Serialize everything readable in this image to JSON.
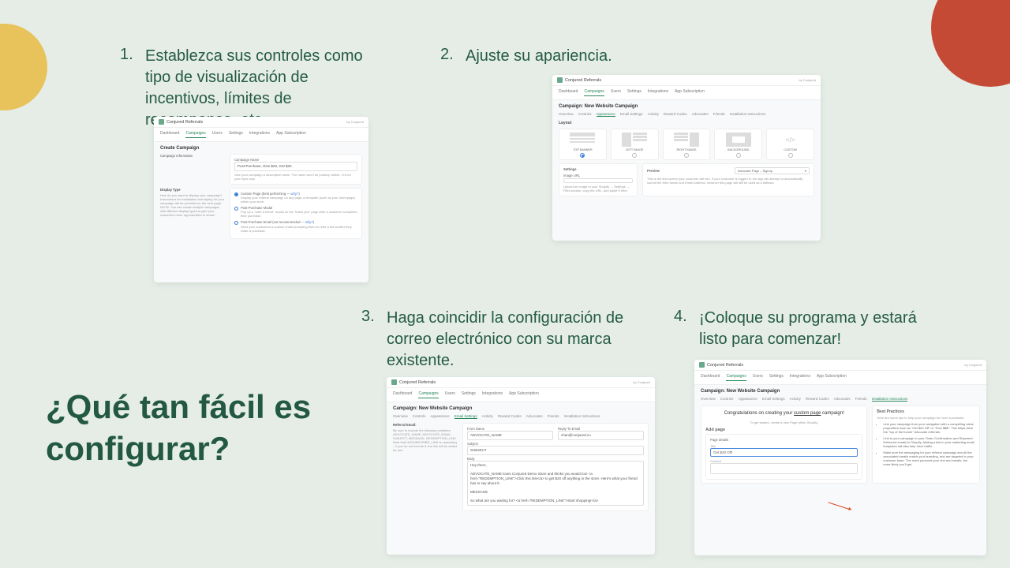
{
  "headline": "¿Qué tan fácil es configurar?",
  "steps": {
    "s1": {
      "num": "1.",
      "text": "Establezca sus controles como tipo de visualización de incentivos, límites de recompensa, etc."
    },
    "s2": {
      "num": "2.",
      "text": "Ajuste su apariencia."
    },
    "s3": {
      "num": "3.",
      "text": "Haga coincidir la configuración de correo electrónico con su marca existente."
    },
    "s4": {
      "num": "4.",
      "text": "¡Coloque su programa y estará listo para comenzar!"
    }
  },
  "app": {
    "title": "Conjured Referrals",
    "by": "by Conjured",
    "nav": [
      "Dashboard",
      "Campaigns",
      "Users",
      "Settings",
      "Integrations",
      "App Subscription"
    ],
    "subtabs": [
      "Overview",
      "Controls",
      "Appearance",
      "Email Settings",
      "Activity",
      "Reward Codes",
      "Advocates",
      "Friends",
      "Installation Instructions"
    ]
  },
  "shot1": {
    "heading": "Create Campaign",
    "sectionA": {
      "label": "Campaign Information",
      "fieldLabel": "Campaign Name",
      "value": "Post-Purchase, Give $20, Get $20",
      "hint": "Give your campaign a descriptive name. The name won't be publicly visible – it's for your eyes only."
    },
    "sectionB": {
      "label": "Display Type",
      "desc": "How do you want to display your campaign? Instructions for installation and styling for your campaign will be provided on the next page. NOTE: You can create multiple campaigns with different display types to give your customers more opportunities to share!",
      "opts": [
        {
          "title": "Custom Page (best performing — ",
          "why": "why?",
          "tail": ")",
          "sub": "Display your referral campaign on any page or template (such as your homepage) within your store."
        },
        {
          "title": "Post-Purchase Modal",
          "sub": "Pop up a \"refer a friend\" modal on the \"thank you\" page after a customer completes their purchase."
        },
        {
          "title": "Post-Purchase Email (not recommended — ",
          "why": "why?",
          "tail": ")",
          "sub": "Send your customers a custom email prompting them to refer a friend after they make a purchase."
        }
      ]
    }
  },
  "shot2": {
    "heading": "Campaign: New Website Campaign",
    "layoutLabel": "Layout",
    "layouts": [
      "TOP BANNER",
      "LEFT IMAGE",
      "RIGHT IMAGE",
      "BACKGROUND",
      "CUSTOM"
    ],
    "settingsLabel": "Settings",
    "imageUrl": "Image URL",
    "imageHint": "Upload an image to your Shopify → Settings → Files section, copy the URL, and paste it here.",
    "previewLabel": "Preview ",
    "previewSelect": "Advocate Page – Signup",
    "previewText": "This is the first screen your customer will see. If your customer is logged in, the app will attempt to automatically submit the their Name and Email Address, however this page will still be used as a fallback."
  },
  "shot3": {
    "heading": "Campaign: New Website Campaign",
    "left": {
      "label": "Referral Email:",
      "text": "Be sure to include the following variables: ADVOCATE_NAME, ADVOCATE_EMAIL, SUBJECT, MESSAGE, REDEMPTION_LINK. Note that UNSUBSCRIBE_LINK is mandatory – if you do not include it, the link will be added for you."
    },
    "right": {
      "fromLabel": "From Name",
      "fromVal": "ADVOCATE_NAME",
      "replyLabel": "Reply-To Email",
      "replyVal": "chan@conjured.co",
      "subjLabel": "Subject",
      "subjVal": "SUBJECT",
      "bodyLabel": "Body",
      "bodyText": "Hey there,\n\nADVOCATE_NAME loves Conjured Demo Store and thinks you would too! <a href=\"REDEMPTION_LINK\">Click this link</a> to get $20 off anything in the store. Here's what your friend has to say about it:\n\nMESSAGE\n\nSo what are you waiting for? <a href=\"REDEMPTION_LINK\">Start shopping!</a>"
    }
  },
  "shot4": {
    "heading": "Campaign: New Website Campaign",
    "congratsA": "Congratulations on creating your ",
    "congratsU": "custom page",
    "congratsB": " campaign!",
    "sub": "To get started, create a new Page within Shopify.",
    "addPage": "Add page",
    "details": "Page details",
    "detailsTitle": "Title",
    "detailsVal": "Get $20 Off!",
    "contentLabel": "Content",
    "bpTitle": "Best Practices",
    "bpIntro": "Here are some tips to help your campaign be more successful:",
    "bps": [
      "Link your campaign from your navigation with a compelling value proposition such as \"Get $20 Off\" or \"Free $$$\". This helps drive the \"top of the funnel\" Advocate referrals.",
      "Link to your campaign in your Order Confirmation and Shipment Delivered emails in Shopify. Adding a link in your marketing email templates will also help drive traffic.",
      "Make sure the messaging for your referral campaign and all the associated emails match your branding, and are targeted to your customer base. The more personal your text and emails, the more likely you'll get"
    ]
  }
}
